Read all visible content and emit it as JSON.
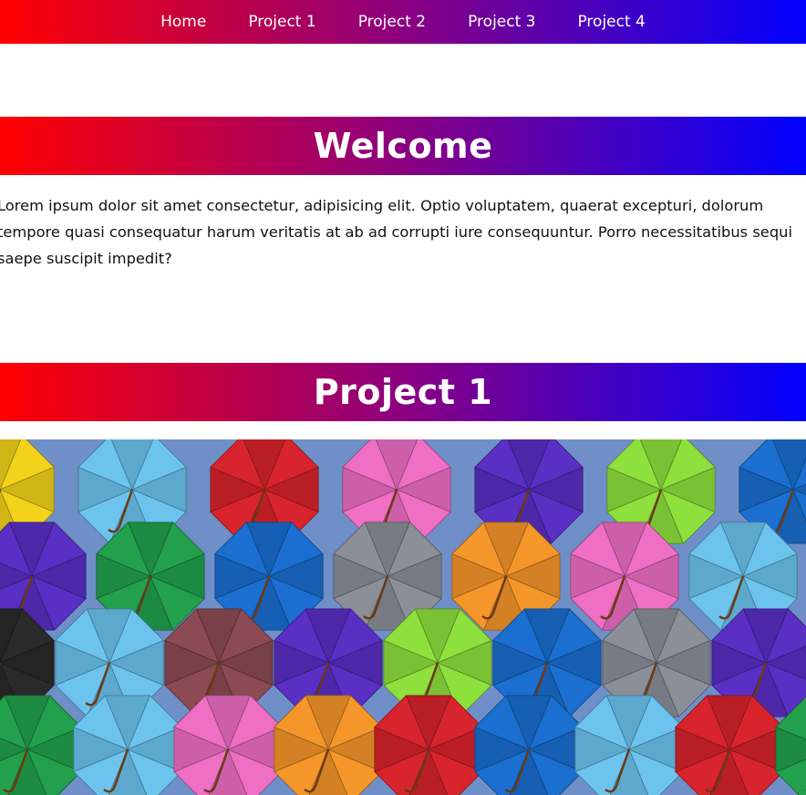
{
  "nav": {
    "items": [
      "Home",
      "Project 1",
      "Project 2",
      "Project 3",
      "Project 4"
    ]
  },
  "welcome": {
    "title": "Welcome",
    "body": "Lorem ipsum dolor sit amet consectetur, adipisicing elit. Optio voluptatem, quaerat excepturi, dolorum tempore quasi consequatur harum veritatis at ab ad corrupti iure consequuntur. Porro necessitatibus sequi saepe suscipit impedit?"
  },
  "project1": {
    "title": "Project 1"
  },
  "colors": {
    "gradient_start": "#ff0000",
    "gradient_end": "#0000ff",
    "sky": "#6f8fc8"
  }
}
